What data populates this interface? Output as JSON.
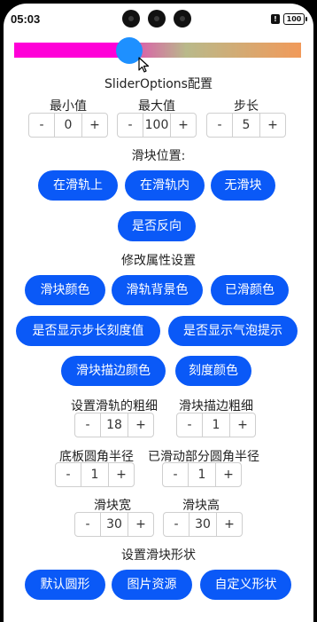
{
  "status_bar": {
    "time": "05:03",
    "alert_glyph": "!",
    "battery_text": "100"
  },
  "slider": {
    "value": 40,
    "min": 0,
    "max": 100,
    "colors": {
      "selected": "#ff00d8",
      "track_start": "#ff00cc",
      "track_end": "#f19a5a",
      "thumb": "#1e90ff"
    }
  },
  "titles": {
    "options": "SliderOptions配置",
    "slider_position": "滑块位置:",
    "modify_props": "修改属性设置",
    "slider_shape": "设置滑块形状"
  },
  "steppers": {
    "min": {
      "label": "最小值",
      "value": "0"
    },
    "max": {
      "label": "最大值",
      "value": "100"
    },
    "step": {
      "label": "步长",
      "value": "5"
    },
    "track_thickness": {
      "label": "设置滑轨的粗细",
      "value": "18"
    },
    "thumb_border_width": {
      "label": "滑块描边粗细",
      "value": "1"
    },
    "base_radius": {
      "label": "底板圆角半径",
      "value": "1"
    },
    "selected_radius": {
      "label": "已滑动部分圆角半径",
      "value": "1"
    },
    "thumb_width": {
      "label": "滑块宽",
      "value": "30"
    },
    "thumb_height": {
      "label": "滑块高",
      "value": "30"
    },
    "minus": "-",
    "plus": "+"
  },
  "buttons": {
    "on_track": "在滑轨上",
    "in_track": "在滑轨内",
    "no_thumb": "无滑块",
    "reverse": "是否反向",
    "thumb_color": "滑块颜色",
    "track_bg_color": "滑轨背景色",
    "selected_color": "已滑颜色",
    "show_steps": "是否显示步长刻度值",
    "show_tips": "是否显示气泡提示",
    "thumb_border_color": "滑块描边颜色",
    "scale_color": "刻度颜色",
    "default_circle": "默认圆形",
    "image_resource": "图片资源",
    "custom_shape": "自定义形状"
  },
  "accent_color": "#0a59f7"
}
